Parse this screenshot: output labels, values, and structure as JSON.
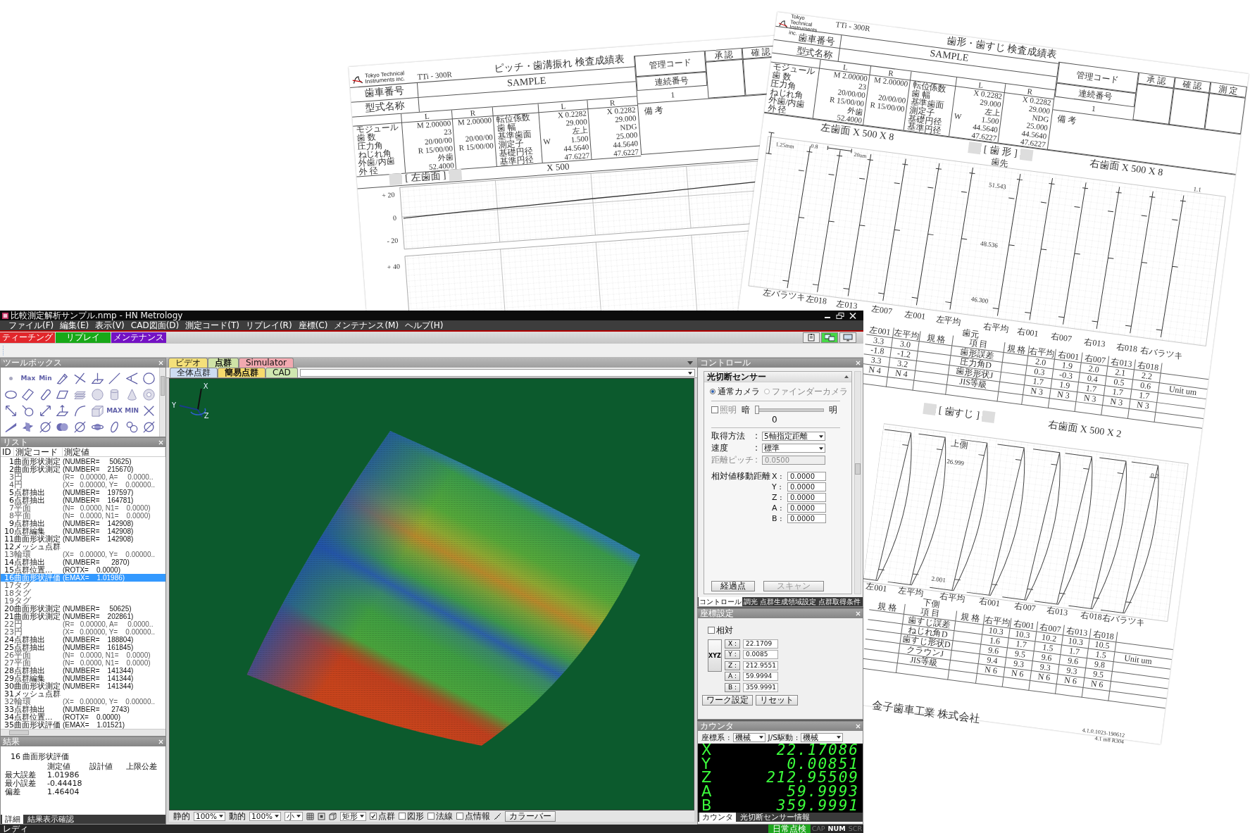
{
  "pitch_report": {
    "logo": [
      "Tokyo Technical",
      "Instruments inc."
    ],
    "model": "TTi - 300R",
    "title": "ピッチ・歯溝振れ  検査成績表",
    "gear_no_label": "歯車番号",
    "gear_no": "SAMPLE",
    "type_label": "型式名称",
    "specs": {
      "headers": [
        "L",
        "R"
      ],
      "rows": [
        {
          "label": "モジュール",
          "l": "M  2.00000",
          "r": "M  2.00000"
        },
        {
          "label": "歯 数",
          "l": "23"
        },
        {
          "label": "圧力角",
          "l": "20/00/00",
          "r": "20/00/00"
        },
        {
          "label": "ねじれ角",
          "l": "R 15/00/00",
          "r": "R 15/00/00"
        },
        {
          "label": "外歯/内歯",
          "l": "外歯"
        },
        {
          "label": "外 径",
          "l": "52.4000"
        }
      ]
    },
    "specs2": {
      "headers": [
        "L",
        "R"
      ],
      "rows": [
        {
          "label": "転位係数",
          "l": "X  0.2282",
          "r": "X  0.2282"
        },
        {
          "label": "歯 幅",
          "l": "29.000",
          "r": "29.000"
        },
        {
          "label": "基準歯面",
          "l": "左上",
          "r": "NDG"
        },
        {
          "label": "測定子",
          "mark": "W",
          "l": "1.500",
          "r": "25.000"
        },
        {
          "label": "基礎円径",
          "l": "44.5640",
          "r": "44.5640"
        },
        {
          "label": "基準円径",
          "l": "47.6227",
          "r": "47.6227"
        }
      ]
    },
    "control_code_label": "管理コード",
    "approvals": [
      "承 認",
      "確 認"
    ],
    "serial_label": "連続番号",
    "serial": "1",
    "remarks_label": "備 考",
    "section": "[ 左歯面 ]",
    "scale": "X 500",
    "chart_ticks": [
      "+ 20",
      "0",
      "- 20",
      "+ 40"
    ]
  },
  "profile_report": {
    "logo": [
      "Tokyo Technical",
      "Instruments inc."
    ],
    "model": "TTi - 300R",
    "title": "歯形・歯すじ  検査成績表",
    "gear_no_label": "歯車番号",
    "gear_no": "SAMPLE",
    "type_label": "型式名称",
    "specs": {
      "headers": [
        "L",
        "R"
      ],
      "rows": [
        {
          "label": "モジュール",
          "l": "M  2.00000",
          "r": "M  2.00000"
        },
        {
          "label": "歯 数",
          "l": "23"
        },
        {
          "label": "圧力角",
          "l": "20/00/00",
          "r": "20/00/00"
        },
        {
          "label": "ねじれ角",
          "l": "R 15/00/00",
          "r": "R 15/00/00"
        },
        {
          "label": "外歯/内歯",
          "l": "外歯"
        },
        {
          "label": "外 径",
          "l": "52.4000"
        }
      ]
    },
    "specs2": {
      "headers": [
        "L",
        "R"
      ],
      "rows": [
        {
          "label": "転位係数",
          "l": "X  0.2282",
          "r": "X  0.2282"
        },
        {
          "label": "歯 幅",
          "l": "29.000",
          "r": "29.000"
        },
        {
          "label": "基準歯面",
          "l": "左上",
          "r": "NDG"
        },
        {
          "label": "測定子",
          "mark": "W",
          "l": "1.500",
          "r": "25.000"
        },
        {
          "label": "基礎円径",
          "l": "44.5640",
          "r": "44.5640"
        },
        {
          "label": "基準円径",
          "l": "47.6227",
          "r": "47.6227"
        }
      ]
    },
    "control_code_label": "管理コード",
    "approvals": [
      "承 認",
      "確 認",
      "測 定"
    ],
    "serial_label": "連続番号",
    "serial": "1",
    "remarks_label": "備 考",
    "profile": {
      "left_title": "左歯面  X 500  X 8",
      "section": "[ 歯 形 ]",
      "right_title": "右歯面  X 500  X 8",
      "scale": [
        "1.25mm",
        "0.8",
        "20um"
      ],
      "tip": "歯先",
      "values": [
        "51.543",
        "48.536",
        "46.300"
      ],
      "corner": "1.1",
      "root": "歯元",
      "traces": [
        "左バラツキ",
        "左018",
        "左013",
        "左007",
        "左001",
        "左平均",
        "右平均",
        "右001",
        "右007",
        "右013",
        "右018",
        "右バラツキ"
      ]
    },
    "profile_table": {
      "left_columns": [
        "左001",
        "左平均"
      ],
      "left_values": [
        [
          "3.3",
          "-1.8",
          "3.3",
          "N 4"
        ],
        [
          "3.0",
          "-1.2",
          "3.2",
          "N 4"
        ]
      ],
      "spec_label": "規 格",
      "item_label": "項 目",
      "items": [
        "歯形誤差",
        "圧力角D",
        "歯形形状J",
        "JIS等級"
      ],
      "spec_label2": "規 格",
      "right_columns": [
        "右平均",
        "右001",
        "右007",
        "右013",
        "右018"
      ],
      "right_values": [
        [
          "2.0",
          "0.3",
          "1.7",
          "N 3"
        ],
        [
          "1.9",
          "-0.3",
          "1.9",
          "N 3"
        ],
        [
          "2.0",
          "0.4",
          "1.7",
          "N 3"
        ],
        [
          "2.1",
          "0.5",
          "1.7",
          "N 3"
        ],
        [
          "2.2",
          "0.6",
          "1.7",
          "N 3"
        ]
      ],
      "unit": "Unit  um"
    },
    "lead": {
      "section": "[ 歯すじ ]",
      "title": "右歯面  X 500  X 2",
      "top": "上側",
      "values": [
        "26.999",
        "2.001"
      ],
      "corner": "0.2",
      "bottom": "下側",
      "traces": [
        "左001",
        "左平均",
        "右平均",
        "右001",
        "右007",
        "右013",
        "右018",
        "右バラツキ"
      ]
    },
    "lead_table": {
      "spec_label": "規 格",
      "item_label": "項 目",
      "items": [
        "歯すじ誤差",
        "ねじれ角D",
        "歯すじ形状D",
        "クラウンJ",
        "JIS等級"
      ],
      "spec_label2": "規 格",
      "right_columns": [
        "右平均",
        "右001",
        "右007",
        "右013",
        "右018"
      ],
      "right_values": [
        [
          "10.3",
          "1.6",
          "9.6",
          "9.4",
          "N 6"
        ],
        [
          "10.3",
          "1.7",
          "9.5",
          "9.3",
          "N 6"
        ],
        [
          "10.2",
          "1.5",
          "9.6",
          "9.3",
          "N 6"
        ],
        [
          "10.3",
          "1.7",
          "9.6",
          "9.3",
          "N 6"
        ],
        [
          "10.5",
          "1.5",
          "9.8",
          "9.5",
          "N 6"
        ]
      ],
      "unit": "Unit  um"
    },
    "company": "金子歯車工業  株式会社",
    "version": [
      "4.1.0.1023-190612",
      "4.1  m8 R304"
    ]
  },
  "app": {
    "title": "比較測定解析サンプル.nmp - HN Metrology",
    "menu": [
      "ファイル(F)",
      "編集(E)",
      "表示(V)",
      "CAD図面(D)",
      "測定コード(T)",
      "リプレイ(R)",
      "座標(C)",
      "メンテナンス(M)",
      "ヘルプ(H)"
    ],
    "mode_tabs": [
      {
        "label": "ティーチング",
        "color": "#e2262b"
      },
      {
        "label": "リプレイ",
        "color": "#18a818"
      },
      {
        "label": "メンテナンス",
        "color": "#7412c4"
      }
    ],
    "toolbar_buttons": [
      {
        "selected": false
      },
      {
        "selected": true
      },
      {
        "selected": false
      }
    ],
    "toolbox": {
      "title": "ツールボックス",
      "text_tools": [
        "Max",
        "Min",
        "MAX",
        "MIN"
      ]
    },
    "list": {
      "title": "リスト",
      "columns": [
        "ID",
        "測定コード",
        "測定値"
      ],
      "rows": [
        {
          "id": "1",
          "code": "曲面形状測定",
          "value": "(NUMBER=     50625)",
          "disabled": false,
          "selected": false
        },
        {
          "id": "2",
          "code": "曲面形状測定",
          "value": "(NUMBER=    215670)",
          "disabled": false,
          "selected": false
        },
        {
          "id": "3",
          "code": "円",
          "value": "(R=   0.00000, A=     0.0000..",
          "disabled": true,
          "selected": false
        },
        {
          "id": "4",
          "code": "円",
          "value": "(X=   0.00000, Y=    0.00000..",
          "disabled": true,
          "selected": false
        },
        {
          "id": "5",
          "code": "点群抽出",
          "value": "(NUMBER=    197597)",
          "disabled": false,
          "selected": false
        },
        {
          "id": "6",
          "code": "点群抽出",
          "value": "(NUMBER=    164781)",
          "disabled": false,
          "selected": false
        },
        {
          "id": "7",
          "code": "平面",
          "value": "(N=   0.0000, N1=    0.0000)",
          "disabled": true,
          "selected": false
        },
        {
          "id": "8",
          "code": "平面",
          "value": "(N=   0.0000, N1=    0.0000)",
          "disabled": true,
          "selected": false
        },
        {
          "id": "9",
          "code": "点群抽出",
          "value": "(NUMBER=    142908)",
          "disabled": false,
          "selected": false
        },
        {
          "id": "10",
          "code": "点群編集",
          "value": "(NUMBER=    142908)",
          "disabled": false,
          "selected": false
        },
        {
          "id": "11",
          "code": "曲面形状測定",
          "value": "(NUMBER=    142908)",
          "disabled": false,
          "selected": false
        },
        {
          "id": "12",
          "code": "メッシュ点群",
          "disabled": false,
          "selected": false
        },
        {
          "id": "13",
          "code": "輪環",
          "value": "(X=   0.00000, Y=    0.00000..",
          "disabled": true,
          "selected": false
        },
        {
          "id": "14",
          "code": "点群抽出",
          "value": "(NUMBER=      2870)",
          "disabled": false,
          "selected": false
        },
        {
          "id": "15",
          "code": "点群位置...",
          "value": "(ROTX=    0.0000)",
          "disabled": false,
          "selected": false
        },
        {
          "id": "16",
          "code": "曲面形状評価",
          "value": "(EMAX=    1.01986)",
          "disabled": false,
          "selected": true
        },
        {
          "id": "17",
          "code": "タグ",
          "disabled": true,
          "selected": false
        },
        {
          "id": "18",
          "code": "タグ",
          "disabled": true,
          "selected": false
        },
        {
          "id": "19",
          "code": "タグ",
          "disabled": true,
          "selected": false
        },
        {
          "id": "20",
          "code": "曲面形状測定",
          "value": "(NUMBER=     50625)",
          "disabled": false,
          "selected": false
        },
        {
          "id": "21",
          "code": "曲面形状測定",
          "value": "(NUMBER=    202861)",
          "disabled": false,
          "selected": false
        },
        {
          "id": "22",
          "code": "円",
          "value": "(R=   0.00000, A=     0.0000..",
          "disabled": true,
          "selected": false
        },
        {
          "id": "23",
          "code": "円",
          "value": "(X=   0.00000, Y=    0.00000..",
          "disabled": true,
          "selected": false
        },
        {
          "id": "24",
          "code": "点群抽出",
          "value": "(NUMBER=    188804)",
          "disabled": false,
          "selected": false
        },
        {
          "id": "25",
          "code": "点群抽出",
          "value": "(NUMBER=    161845)",
          "disabled": false,
          "selected": false
        },
        {
          "id": "26",
          "code": "平面",
          "value": "(N=   0.0000, N1=    0.0000)",
          "disabled": true,
          "selected": false
        },
        {
          "id": "27",
          "code": "平面",
          "value": "(N=   0.0000, N1=    0.0000)",
          "disabled": true,
          "selected": false
        },
        {
          "id": "28",
          "code": "点群抽出",
          "value": "(NUMBER=    141344)",
          "disabled": false,
          "selected": false
        },
        {
          "id": "29",
          "code": "点群編集",
          "value": "(NUMBER=    141344)",
          "disabled": false,
          "selected": false
        },
        {
          "id": "30",
          "code": "曲面形状測定",
          "value": "(NUMBER=    141344)",
          "disabled": false,
          "selected": false
        },
        {
          "id": "31",
          "code": "メッシュ点群",
          "disabled": false,
          "selected": false
        },
        {
          "id": "32",
          "code": "輪環",
          "value": "(X=   0.00000, Y=    0.00000..",
          "disabled": true,
          "selected": false
        },
        {
          "id": "33",
          "code": "点群抽出",
          "value": "(NUMBER=      2743)",
          "disabled": false,
          "selected": false
        },
        {
          "id": "34",
          "code": "点群位置...",
          "value": "(ROTX=    0.0000)",
          "disabled": false,
          "selected": false
        },
        {
          "id": "35",
          "code": "曲面形状評価",
          "value": "(EMAX=    1.01521)",
          "disabled": false,
          "selected": false
        }
      ]
    },
    "result": {
      "title": "結果",
      "heading": "16 曲面形状評価",
      "columns": [
        "測定値",
        "設計値",
        "上限公差"
      ],
      "rows": [
        {
          "label": "最大誤差",
          "value": "1.01986"
        },
        {
          "label": "最小誤差",
          "value": "-0.44418"
        },
        {
          "label": "偏差",
          "value": "1.46404"
        }
      ],
      "tabs": [
        {
          "label": "詳細",
          "selected": true
        },
        {
          "label": "結果表示確認",
          "selected": false
        }
      ]
    },
    "viewport": {
      "tabs": [
        {
          "label": "ビデオ",
          "color": "#f4e07a",
          "selected": false
        },
        {
          "label": "点群",
          "color": "#cfe3a6",
          "selected": true
        },
        {
          "label": "Simulator",
          "color": "#f2a9b0",
          "selected": false
        }
      ],
      "subtabs": [
        {
          "label": "全体点群",
          "color": "#cddcf2",
          "selected": false
        },
        {
          "label": "簡易点群",
          "color": "#f6da6c",
          "selected": true
        },
        {
          "label": "CAD",
          "color": "#cfe6b0",
          "selected": false
        }
      ],
      "axis_labels": [
        "X",
        "Y",
        "Z"
      ],
      "bottom_toolbar": {
        "static_label": "静的",
        "static_zoom": "100%",
        "dynamic_label": "動的",
        "dynamic_zoom": "100%",
        "size": "小",
        "select_mode": "矩形",
        "checks": [
          {
            "label": "点群",
            "checked": true
          },
          {
            "label": "図形",
            "checked": false
          },
          {
            "label": "法線",
            "checked": false
          },
          {
            "label": "点情報",
            "checked": false
          }
        ],
        "colorbar": "カラーバー"
      }
    },
    "control": {
      "title": "コントロール",
      "section": "光切断センサー",
      "cameras": [
        {
          "label": "通常カメラ",
          "selected": true,
          "disabled": false
        },
        {
          "label": "ファインダーカメラ",
          "selected": false,
          "disabled": true
        }
      ],
      "light": {
        "label": "照明",
        "checked": false,
        "disabled": true,
        "dark": "暗",
        "bright": "明",
        "level": 0,
        "reading": "0"
      },
      "fields": [
        {
          "label": "取得方法",
          "sep": ":",
          "value": "5軸指定距離",
          "kind": "dropdown",
          "disabled": false
        },
        {
          "label": "速度",
          "sep": ":",
          "value": "標準",
          "kind": "dropdown",
          "disabled": false
        },
        {
          "label": "距離ピッチ",
          "sep": ":",
          "value": "0.0500",
          "kind": "text",
          "disabled": true
        }
      ],
      "move_label": "相対値移動距離",
      "moves": [
        {
          "axis": "X :",
          "value": "0.0000"
        },
        {
          "axis": "Y :",
          "value": "0.0000"
        },
        {
          "axis": "Z :",
          "value": "0.0000"
        },
        {
          "axis": "A :",
          "value": "0.0000"
        },
        {
          "axis": "B :",
          "value": "0.0000"
        }
      ],
      "buttons": [
        {
          "label": "経過点",
          "disabled": false
        },
        {
          "label": "スキャン",
          "disabled": true
        }
      ],
      "tabs": [
        {
          "label": "コントロール",
          "selected": true
        },
        {
          "label": "調光",
          "selected": false
        },
        {
          "label": "点群生成領域設定",
          "selected": false
        },
        {
          "label": "点群取得条件",
          "selected": false
        }
      ]
    },
    "coords": {
      "title": "座標設定",
      "relative": {
        "label": "相対",
        "checked": false
      },
      "xyz_button": "XYZ",
      "axes": [
        {
          "axis": "X :",
          "value": "22.1709"
        },
        {
          "axis": "Y :",
          "value": "0.0085"
        },
        {
          "axis": "Z :",
          "value": "212.9551"
        },
        {
          "axis": "A :",
          "value": "59.9994"
        },
        {
          "axis": "B :",
          "value": "359.9991"
        }
      ],
      "buttons": [
        "ワーク設定",
        "リセット"
      ]
    },
    "counter": {
      "title": "カウンタ",
      "system_label": "座標系",
      "system_sep": ":",
      "system": "機械",
      "drive_label": "J/S駆動",
      "drive_sep": ":",
      "drive": "機械",
      "readouts": [
        {
          "axis": "X",
          "value": "22.17086"
        },
        {
          "axis": "Y",
          "value": "0.00851"
        },
        {
          "axis": "Z",
          "value": "212.95509"
        },
        {
          "axis": "A",
          "value": "59.9993"
        },
        {
          "axis": "B",
          "value": "359.9991"
        }
      ],
      "tabs": [
        {
          "label": "カウンタ",
          "selected": true
        },
        {
          "label": "光切断センサー情報",
          "selected": false
        }
      ]
    },
    "status": {
      "text": "レディ",
      "mode": "日常点検",
      "indicators": [
        {
          "label": "CAP",
          "on": false
        },
        {
          "label": "NUM",
          "on": true
        },
        {
          "label": "SCR",
          "on": false
        }
      ]
    }
  }
}
